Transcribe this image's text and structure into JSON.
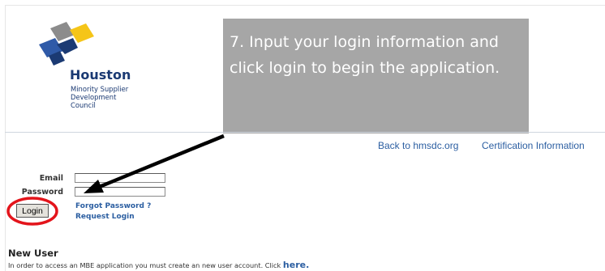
{
  "logo": {
    "title": "Houston",
    "subtitle_line1": "Minority Supplier",
    "subtitle_line2": "Development Council",
    "colors": {
      "navy": "#1b3a73",
      "yellow": "#f5c518",
      "gray": "#8c8c8c",
      "blue": "#2f5aa8"
    }
  },
  "callout": {
    "text": "7. Input your login information and click login to begin the application.",
    "background": "#a6a6a6"
  },
  "nav": {
    "home_link": "Back to hmsdc.org",
    "certification_link": "Certification Information"
  },
  "login": {
    "email_label": "Email",
    "password_label": "Password",
    "email_value": "",
    "password_value": "",
    "button_label": "Login",
    "forgot_link": "Forgot Password ?",
    "request_link": "Request Login"
  },
  "new_user": {
    "title": "New User",
    "text": "In order to access an MBE application you must create an new user account. Click ",
    "link": "here."
  },
  "annotations": {
    "circle_color": "#e3141b",
    "arrow_color": "#000000"
  }
}
